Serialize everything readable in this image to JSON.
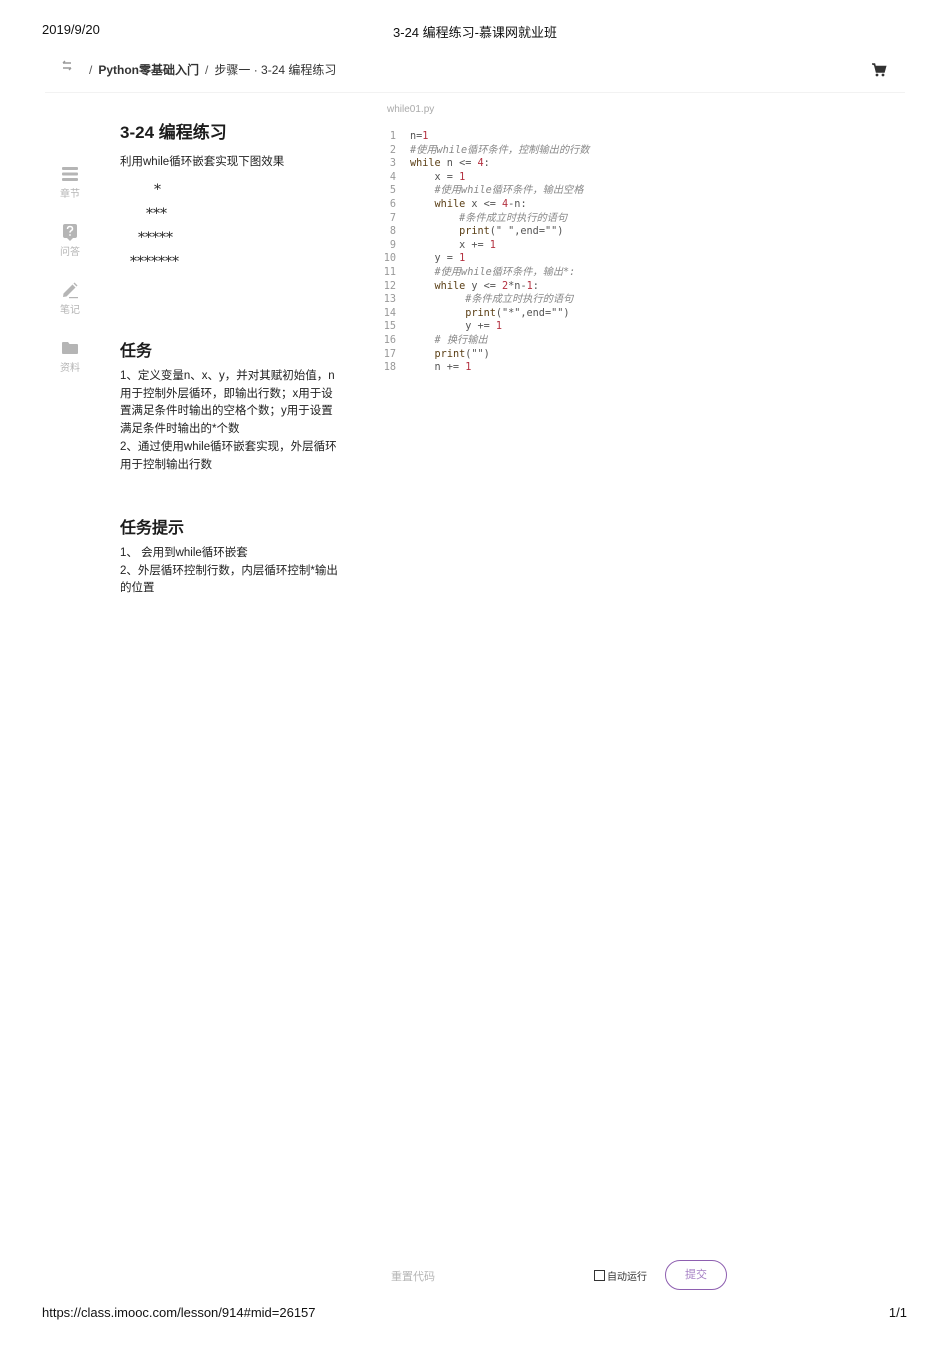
{
  "print": {
    "date": "2019/9/20",
    "title": "3-24 编程练习-慕课网就业班",
    "url": "https://class.imooc.com/lesson/914#mid=26157",
    "page": "1/1"
  },
  "topbar": {
    "sep": "/",
    "course": "Python零基础入门",
    "step": "步骤一 · 3-24 编程练习",
    "icons": [
      "back-arrows-icon",
      "cart-icon"
    ]
  },
  "sidebar": {
    "items": [
      {
        "label": "章节",
        "icon": "chapter-icon"
      },
      {
        "label": "问答",
        "icon": "question-icon"
      },
      {
        "label": "笔记",
        "icon": "pencil-icon"
      },
      {
        "label": "资料",
        "icon": "folder-icon"
      }
    ]
  },
  "exercise": {
    "title": "3-24 编程练习",
    "description": "利用while循环嵌套实现下图效果",
    "star_rows": [
      "*",
      "***",
      "*****",
      "*******"
    ],
    "task_heading": "任务",
    "task_lines": [
      "1、定义变量n、x、y，并对其赋初始值，n",
      "用于控制外层循环，即输出行数；x用于设",
      "置满足条件时输出的空格个数；y用于设置",
      "满足条件时输出的*个数",
      "2、通过使用while循环嵌套实现，外层循环",
      "用于控制输出行数"
    ],
    "hint_heading": "任务提示",
    "hint_lines": [
      "1、 会用到while循环嵌套",
      "2、外层循环控制行数，内层循环控制*输出",
      "的位置"
    ]
  },
  "editor": {
    "filename": "while01.py",
    "lines": [
      {
        "n": "1",
        "code": "n=1"
      },
      {
        "n": "2",
        "code": "#使用while循环条件，控制输出的行数"
      },
      {
        "n": "3",
        "code": "while n <= 4:"
      },
      {
        "n": "4",
        "code": "    x = 1"
      },
      {
        "n": "5",
        "code": "    #使用while循环条件，输出空格"
      },
      {
        "n": "6",
        "code": "    while x <= 4-n:"
      },
      {
        "n": "7",
        "code": "        #条件成立时执行的语句"
      },
      {
        "n": "8",
        "code": "        print(\" \",end=\"\")"
      },
      {
        "n": "9",
        "code": "        x += 1"
      },
      {
        "n": "10",
        "code": "    y = 1"
      },
      {
        "n": "11",
        "code": "    #使用while循环条件，输出*:"
      },
      {
        "n": "12",
        "code": "    while y <= 2*n-1:"
      },
      {
        "n": "13",
        "code": "         #条件成立时执行的语句"
      },
      {
        "n": "14",
        "code": "         print(\"*\",end=\"\")"
      },
      {
        "n": "15",
        "code": "         y += 1"
      },
      {
        "n": "16",
        "code": "    # 换行输出"
      },
      {
        "n": "17",
        "code": "    print(\"\")"
      },
      {
        "n": "18",
        "code": "    n += 1"
      }
    ]
  },
  "controls": {
    "reset_label": "重置代码",
    "auto_run_label": "自动运行",
    "auto_run_checked": false,
    "submit_label": "提交",
    "accent_color": "#8e5fb0"
  }
}
